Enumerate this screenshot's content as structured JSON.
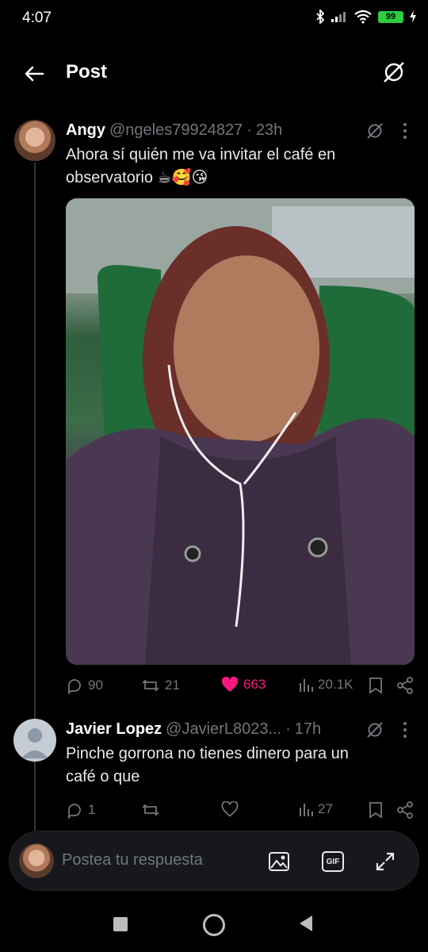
{
  "status": {
    "time": "4:07",
    "battery": "99"
  },
  "header": {
    "title": "Post"
  },
  "tweet": {
    "author_name": "Angy",
    "handle": "@ngeles79924827",
    "separator": "·",
    "time": "23h",
    "text_line1": "Ahora sí quién me va invitar el café en",
    "text_line2": "observatorio ☕🥰😘",
    "stats": {
      "replies": "90",
      "reposts": "21",
      "likes": "663",
      "views": "20.1K"
    },
    "colors": {
      "like": "#f91880",
      "muted": "#71767b"
    }
  },
  "reply": {
    "author_name": "Javier Lopez",
    "handle": "@JavierL8023...",
    "separator": "·",
    "time": "17h",
    "text_line1": "Pinche gorrona no tienes dinero para un",
    "text_line2": "café o que",
    "stats": {
      "replies": "1",
      "views": "27"
    }
  },
  "composer": {
    "placeholder": "Postea tu respuesta",
    "gif_label": "GIF"
  }
}
